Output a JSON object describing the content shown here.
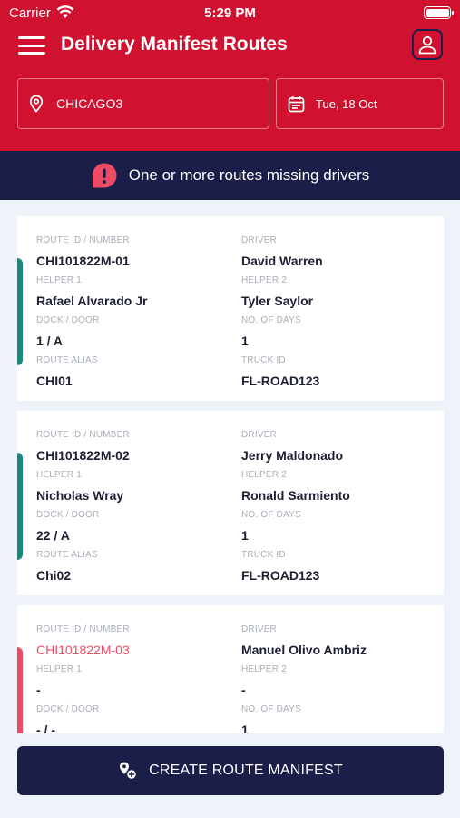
{
  "status_bar": {
    "carrier": "Carrier",
    "time": "5:29 PM"
  },
  "header": {
    "title": "Delivery Manifest Routes"
  },
  "filters": {
    "location": "CHICAGO3",
    "date": "Tue, 18 Oct"
  },
  "alert": {
    "text": "One or more routes missing drivers"
  },
  "labels": {
    "route_id": "ROUTE ID / NUMBER",
    "driver": "DRIVER",
    "helper1": "HELPER 1",
    "helper2": "HELPER 2",
    "dock": "DOCK / DOOR",
    "days": "NO. OF DAYS",
    "alias": "ROUTE ALIAS",
    "truck": "TRUCK ID"
  },
  "routes": [
    {
      "route_id": "CHI101822M-01",
      "driver": "David Warren",
      "helper1": "Rafael Alvarado Jr",
      "helper2": "Tyler Saylor",
      "dock": "1 / A",
      "days": "1",
      "alias": "CHI01",
      "truck": "FL-ROAD123",
      "status": "complete"
    },
    {
      "route_id": "CHI101822M-02",
      "driver": "Jerry Maldonado",
      "helper1": "Nicholas Wray",
      "helper2": "Ronald Sarmiento",
      "dock": "22 / A",
      "days": "1",
      "alias": "Chi02",
      "truck": "FL-ROAD123",
      "status": "complete"
    },
    {
      "route_id": "CHI101822M-03",
      "driver": "Manuel Olivo Ambriz",
      "helper1": "-",
      "helper2": "-",
      "dock": "- / -",
      "days": "1",
      "alias": "",
      "truck": "",
      "status": "missing"
    }
  ],
  "create_button": {
    "label": "CREATE ROUTE MANIFEST"
  },
  "colors": {
    "header": "#d0112f",
    "navy": "#1a1e48",
    "complete": "#168a7e",
    "missing": "#ef4a63"
  },
  "icons": [
    "wifi-icon",
    "battery-icon",
    "menu-icon",
    "user-icon",
    "location-pin-icon",
    "calendar-icon",
    "alert-icon",
    "route-add-icon"
  ]
}
